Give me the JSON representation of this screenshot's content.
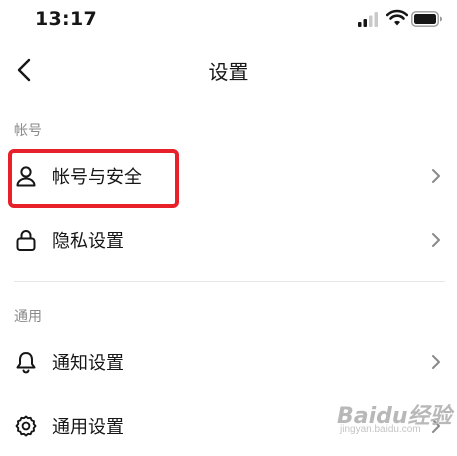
{
  "status_bar": {
    "time": "13:17"
  },
  "header": {
    "title": "设置"
  },
  "sections": [
    {
      "title": "帐号",
      "items": [
        {
          "label": "帐号与安全",
          "icon": "user-icon"
        },
        {
          "label": "隐私设置",
          "icon": "lock-icon"
        }
      ]
    },
    {
      "title": "通用",
      "items": [
        {
          "label": "通知设置",
          "icon": "bell-icon"
        },
        {
          "label": "通用设置",
          "icon": "gear-icon"
        }
      ]
    }
  ],
  "watermark": {
    "text": "Baidu经验",
    "sub": "jingyan.baidu.com"
  },
  "colors": {
    "highlight": "#e8202a",
    "section_text": "#8a8a8a",
    "chevron": "#8a8a8a"
  }
}
